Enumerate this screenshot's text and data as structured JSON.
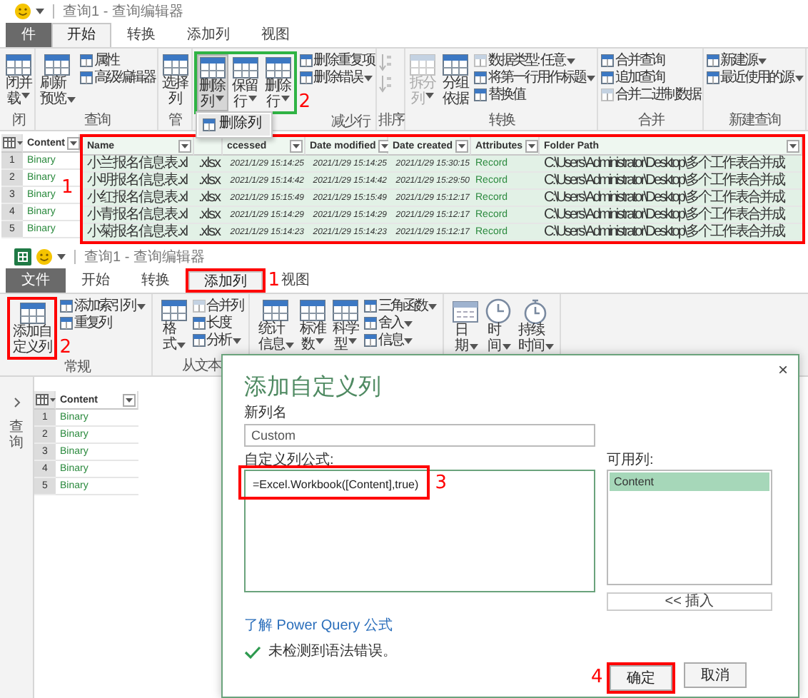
{
  "top": {
    "app_icon": false,
    "title": "查询1 - 查询编辑器",
    "tabs": [
      {
        "label": "件",
        "kind": "file",
        "selected": false
      },
      {
        "label": "开始",
        "kind": "tab",
        "selected": true
      },
      {
        "label": "转换",
        "kind": "tab",
        "selected": false
      },
      {
        "label": "添加列",
        "kind": "tab",
        "selected": false
      },
      {
        "label": "视图",
        "kind": "tab",
        "selected": false
      }
    ],
    "ribbon": [
      {
        "label": "闭",
        "items": [
          {
            "kind": "large",
            "label": "闭并载",
            "dropdown": true,
            "disabled": false
          }
        ]
      },
      {
        "label": "查询",
        "items": [
          {
            "kind": "large",
            "label": "刷新预览",
            "dropdown": true,
            "disabled": false
          },
          {
            "kind": "small",
            "label": "属性",
            "dropdown": false,
            "disabled": false
          },
          {
            "kind": "small",
            "label": "高级编辑器",
            "dropdown": false,
            "disabled": false
          }
        ]
      },
      {
        "label": "管",
        "items": [
          {
            "kind": "large",
            "label": "选择列",
            "dropdown": false,
            "disabled": false
          }
        ]
      },
      {
        "label": "减少行",
        "items": [
          {
            "kind": "frame",
            "mark": {
              "number": "2",
              "color": "#2fb344"
            },
            "items": [
              {
                "kind": "large",
                "label": "删除列",
                "dropdown": true,
                "disabled": false,
                "menu": {
                  "items": [
                    "删除列"
                  ]
                }
              },
              {
                "kind": "large",
                "label": "保留行",
                "dropdown": true,
                "disabled": false
              },
              {
                "kind": "large",
                "label": "删除行",
                "dropdown": true,
                "disabled": false
              }
            ]
          },
          {
            "kind": "small",
            "label": "删除重复项",
            "dropdown": false,
            "disabled": false
          },
          {
            "kind": "small",
            "label": "删除错误",
            "dropdown": true,
            "disabled": false
          }
        ]
      },
      {
        "label": "排序",
        "items": [
          {
            "kind": "icon",
            "disabled": true
          },
          {
            "kind": "icon",
            "disabled": true
          }
        ]
      },
      {
        "label": "转换",
        "items": [
          {
            "kind": "large",
            "label": "拆分列",
            "dropdown": true,
            "disabled": true
          },
          {
            "kind": "large",
            "label": "分组依据",
            "dropdown": false,
            "disabled": false
          },
          {
            "kind": "small",
            "label": "数据类型: 任意",
            "dropdown": true,
            "disabled": true
          },
          {
            "kind": "small",
            "label": "将第一行用作标题",
            "dropdown": true,
            "disabled": false
          },
          {
            "kind": "small",
            "label": "替换值",
            "dropdown": false,
            "disabled": false
          }
        ]
      },
      {
        "label": "合并",
        "items": [
          {
            "kind": "small",
            "label": "合并查询",
            "dropdown": false,
            "disabled": false
          },
          {
            "kind": "small",
            "label": "追加查询",
            "dropdown": false,
            "disabled": false
          },
          {
            "kind": "small",
            "label": "合并二进制数据",
            "dropdown": false,
            "disabled": true
          }
        ]
      },
      {
        "label": "新建查询",
        "items": [
          {
            "kind": "small",
            "label": "新建源",
            "dropdown": true,
            "disabled": false
          },
          {
            "kind": "small",
            "label": "最近使用的源",
            "dropdown": true,
            "disabled": false
          }
        ]
      }
    ],
    "table": {
      "mark": {
        "number": "1",
        "color": "#ff0000"
      },
      "columns": [
        {
          "label": "Content",
          "kind": "value",
          "selected": false
        },
        {
          "label": "Name",
          "kind": "text",
          "selected": true
        },
        {
          "kind": "text",
          "selected": true
        },
        {
          "label": "ccessed",
          "kind": "date",
          "selected": true
        },
        {
          "label": "Date modified",
          "kind": "date",
          "selected": true
        },
        {
          "label": "Date created",
          "kind": "date",
          "selected": true
        },
        {
          "label": "Attributes",
          "kind": "value",
          "selected": true
        },
        {
          "label": "Folder Path",
          "kind": "text",
          "selected": true
        }
      ],
      "rows": [
        {
          "number": "1",
          "cells": [
            "Binary",
            "小兰报名信息表.xl",
            ".xlsx",
            "2021/1/29 15:14:25",
            "2021/1/29 15:14:25",
            "2021/1/29 15:30:15",
            "Record",
            "C:\\Users\\Administrator\\Desktop\\多个工作表合并成"
          ]
        },
        {
          "number": "2",
          "cells": [
            "Binary",
            "小明报名信息表.xl",
            ".xlsx",
            "2021/1/29 15:14:42",
            "2021/1/29 15:14:42",
            "2021/1/29 15:29:50",
            "Record",
            "C:\\Users\\Administrator\\Desktop\\多个工作表合并成"
          ]
        },
        {
          "number": "3",
          "cells": [
            "Binary",
            "小红报名信息表.xl",
            ".xlsx",
            "2021/1/29 15:15:49",
            "2021/1/29 15:15:49",
            "2021/1/29 15:12:17",
            "Record",
            "C:\\Users\\Administrator\\Desktop\\多个工作表合并成"
          ]
        },
        {
          "number": "4",
          "cells": [
            "Binary",
            "小青报名信息表.xl",
            ".xlsx",
            "2021/1/29 15:14:29",
            "2021/1/29 15:14:29",
            "2021/1/29 15:12:17",
            "Record",
            "C:\\Users\\Administrator\\Desktop\\多个工作表合并成"
          ]
        },
        {
          "number": "5",
          "cells": [
            "Binary",
            "小菊报名信息表.xl",
            ".xlsx",
            "2021/1/29 15:14:23",
            "2021/1/29 15:14:23",
            "2021/1/29 15:12:17",
            "Record",
            "C:\\Users\\Administrator\\Desktop\\多个工作表合并成"
          ]
        }
      ]
    }
  },
  "bottom": {
    "app_icon": true,
    "title": "查询1 - 查询编辑器",
    "tabs": [
      {
        "label": "文件",
        "kind": "file",
        "selected": false
      },
      {
        "label": "开始",
        "kind": "tab",
        "selected": false
      },
      {
        "label": "转换",
        "kind": "tab",
        "selected": false
      },
      {
        "label": "添加列",
        "kind": "tab",
        "selected": true,
        "mark": {
          "number": "1",
          "color": "#ff0000"
        }
      },
      {
        "label": "视图",
        "kind": "tab",
        "selected": false
      }
    ],
    "ribbon": [
      {
        "label": "常规",
        "items": [
          {
            "kind": "large",
            "label": "添加自定义列",
            "dropdown": false,
            "disabled": false,
            "mark": {
              "number": "2",
              "color": "#ff0000"
            }
          },
          {
            "kind": "small",
            "label": "添加索引列",
            "dropdown": true,
            "disabled": false
          },
          {
            "kind": "small",
            "label": "重复列",
            "dropdown": false,
            "disabled": false
          }
        ]
      },
      {
        "label": "从文本",
        "items": [
          {
            "kind": "large",
            "label": "格式",
            "dropdown": true,
            "disabled": false
          },
          {
            "kind": "small",
            "label": "合并列",
            "dropdown": false,
            "disabled": true
          },
          {
            "kind": "small",
            "label": "长度",
            "dropdown": false,
            "disabled": false
          },
          {
            "kind": "small",
            "label": "分析",
            "dropdown": true,
            "disabled": false
          }
        ]
      },
      {
        "items": [
          {
            "kind": "large",
            "label": "统计信息",
            "dropdown": true,
            "disabled": false
          },
          {
            "kind": "large",
            "label": "标准数",
            "dropdown": true,
            "disabled": false
          },
          {
            "kind": "large",
            "label": "科学型",
            "dropdown": true,
            "disabled": false
          },
          {
            "kind": "small",
            "label": "三角函数",
            "dropdown": true,
            "disabled": false
          },
          {
            "kind": "small",
            "label": "舍入",
            "dropdown": true,
            "disabled": false
          },
          {
            "kind": "small",
            "label": "信息",
            "dropdown": true,
            "disabled": false
          }
        ]
      },
      {
        "items": [
          {
            "kind": "large",
            "label": "日期",
            "dropdown": true,
            "disabled": false
          },
          {
            "kind": "large",
            "label": "时间",
            "dropdown": true,
            "disabled": false
          },
          {
            "kind": "large",
            "label": "持续时间",
            "dropdown": true,
            "disabled": false
          }
        ]
      }
    ],
    "queries_pane": {
      "label": "查询"
    },
    "table": {
      "columns": [
        {
          "label": "Content",
          "kind": "value",
          "selected": false
        }
      ],
      "rows": [
        {
          "number": "1",
          "cells": [
            "Binary"
          ]
        },
        {
          "number": "2",
          "cells": [
            "Binary"
          ]
        },
        {
          "number": "3",
          "cells": [
            "Binary"
          ]
        },
        {
          "number": "4",
          "cells": [
            "Binary"
          ]
        },
        {
          "number": "5",
          "cells": [
            "Binary"
          ]
        }
      ]
    }
  },
  "dialog": {
    "close": "×",
    "title": "添加自定义列",
    "name_label": "新列名",
    "name_value": "Custom",
    "formula_label": "自定义列公式:",
    "formula": "=Excel.Workbook([Content],true)",
    "formula_mark": {
      "number": "3",
      "color": "#ff0000"
    },
    "columns_label": "可用列:",
    "columns": [
      {
        "label": "Content",
        "selected": true
      }
    ],
    "insert_button": "<< 插入",
    "link": "了解 Power Query 公式",
    "status": "未检测到语法错误。",
    "buttons": [
      {
        "label": "确定",
        "mark": {
          "number": "4",
          "color": "#ff0000"
        }
      },
      {
        "label": "取消"
      }
    ]
  }
}
